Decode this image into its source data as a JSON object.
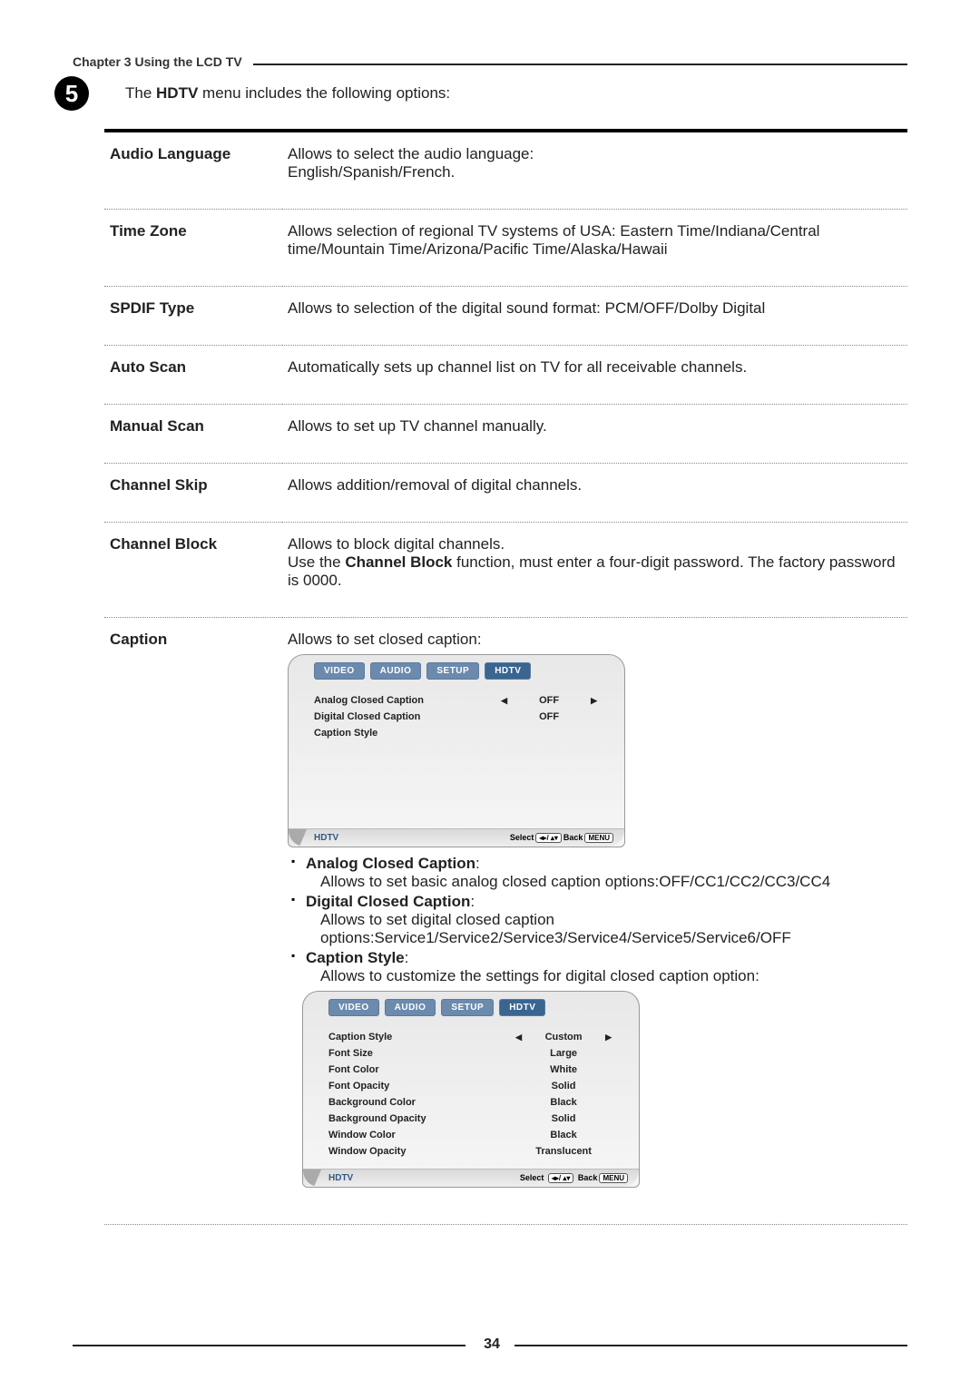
{
  "chapter_header": "Chapter 3 Using the LCD TV",
  "step_number": "5",
  "step_text_pre": "The ",
  "step_text_bold": "HDTV",
  "step_text_post": " menu includes the following options:",
  "rows": {
    "audio_language": {
      "label": "Audio Language",
      "desc": "Allows to select the audio language:\nEnglish/Spanish/French."
    },
    "time_zone": {
      "label": "Time Zone",
      "desc": "Allows selection of regional TV systems of USA: Eastern Time/Indiana/Central time/Mountain Time/Arizona/Pacific Time/Alaska/Hawaii"
    },
    "spdif": {
      "label": "SPDIF Type",
      "desc": "Allows to selection of the digital sound format: PCM/OFF/Dolby Digital"
    },
    "auto_scan": {
      "label": "Auto Scan",
      "desc": "Automatically sets up channel list on TV for all receivable channels."
    },
    "manual_scan": {
      "label": "Manual Scan",
      "desc": "Allows to set up TV channel manually."
    },
    "channel_skip": {
      "label": "Channel Skip",
      "desc": "Allows addition/removal of digital channels."
    },
    "channel_block": {
      "label": "Channel Block",
      "desc_line1": "Allows to block digital channels.",
      "desc_pre": "Use the ",
      "desc_bold": "Channel Block",
      "desc_post": " function, must enter a four-digit password. The factory password is 0000."
    },
    "caption": {
      "label": "Caption",
      "intro": "Allows to set closed caption:",
      "analog_label": "Analog Closed Caption",
      "analog_desc": "Allows to set basic analog closed caption options:OFF/CC1/CC2/CC3/CC4",
      "digital_label": "Digital Closed Caption",
      "digital_desc": "Allows to set digital closed caption options:Service1/Service2/Service3/Service4/Service5/Service6/OFF",
      "style_label": "Caption Style",
      "style_desc": "Allows to customize the settings for digital closed caption option:"
    }
  },
  "osd": {
    "tabs": {
      "video": "VIDEO",
      "audio": "AUDIO",
      "setup": "SETUP",
      "hdtv": "HDTV"
    },
    "footer_title": "HDTV",
    "footer_select": "Select",
    "footer_back": "Back",
    "footer_menu": "MENU",
    "footer_keys": "◂▸/ ▴▾",
    "screen1": {
      "r1_l": "Analog Closed Caption",
      "r1_v": "OFF",
      "r2_l": "Digital Closed Caption",
      "r2_v": "OFF",
      "r3_l": "Caption Style"
    },
    "screen2": {
      "r1_l": "Caption Style",
      "r1_v": "Custom",
      "r2_l": "Font Size",
      "r2_v": "Large",
      "r3_l": "Font Color",
      "r3_v": "White",
      "r4_l": "Font Opacity",
      "r4_v": "Solid",
      "r5_l": "Background Color",
      "r5_v": "Black",
      "r6_l": "Background Opacity",
      "r6_v": "Solid",
      "r7_l": "Window Color",
      "r7_v": "Black",
      "r8_l": "Window Opacity",
      "r8_v": "Translucent"
    }
  },
  "page_number": "34"
}
